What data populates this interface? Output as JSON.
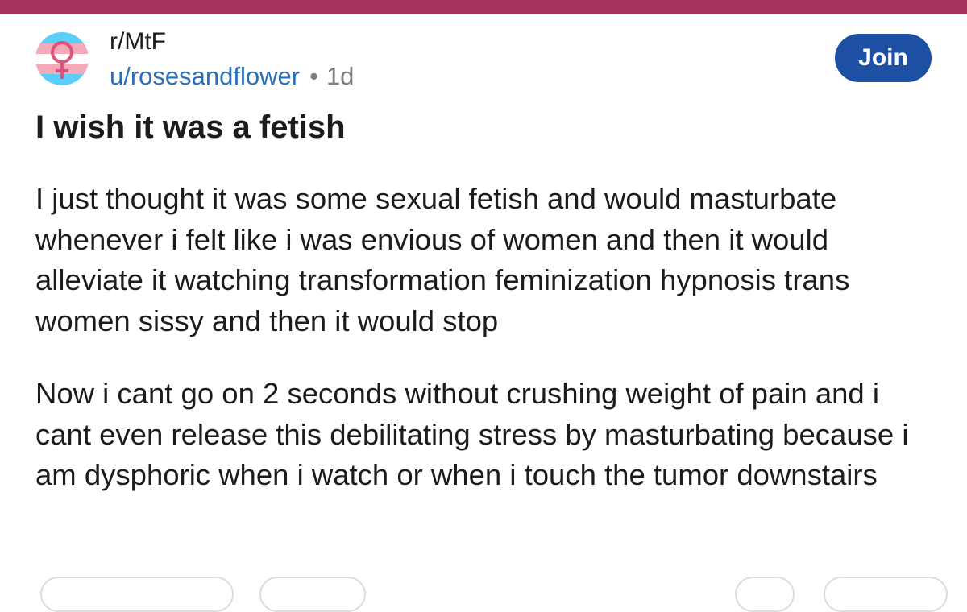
{
  "post": {
    "community": "r/MtF",
    "username": "u/rosesandflower",
    "separator": "•",
    "age": "1d",
    "join_label": "Join",
    "title": "I wish it was a fetish",
    "body": {
      "p1": "I just thought it was some sexual fetish and would masturbate whenever i felt like i was envious of women and then it would alleviate it watching transformation feminization hypnosis trans women sissy and then it would stop",
      "p2": "Now i cant go on 2 seconds without crushing weight of pain and i cant even release this debilitating stress by masturbating because i am dysphoric when i watch or when i touch the tumor downstairs"
    }
  },
  "icons": {
    "community_avatar": "transgender-flag-venus-icon"
  },
  "colors": {
    "top_bar": "#a3325d",
    "join_button": "#1d4fa3",
    "username": "#2a6fb8",
    "flag_blue": "#5bcefa",
    "flag_pink": "#f5a9b8",
    "venus_symbol": "#e0527e"
  }
}
